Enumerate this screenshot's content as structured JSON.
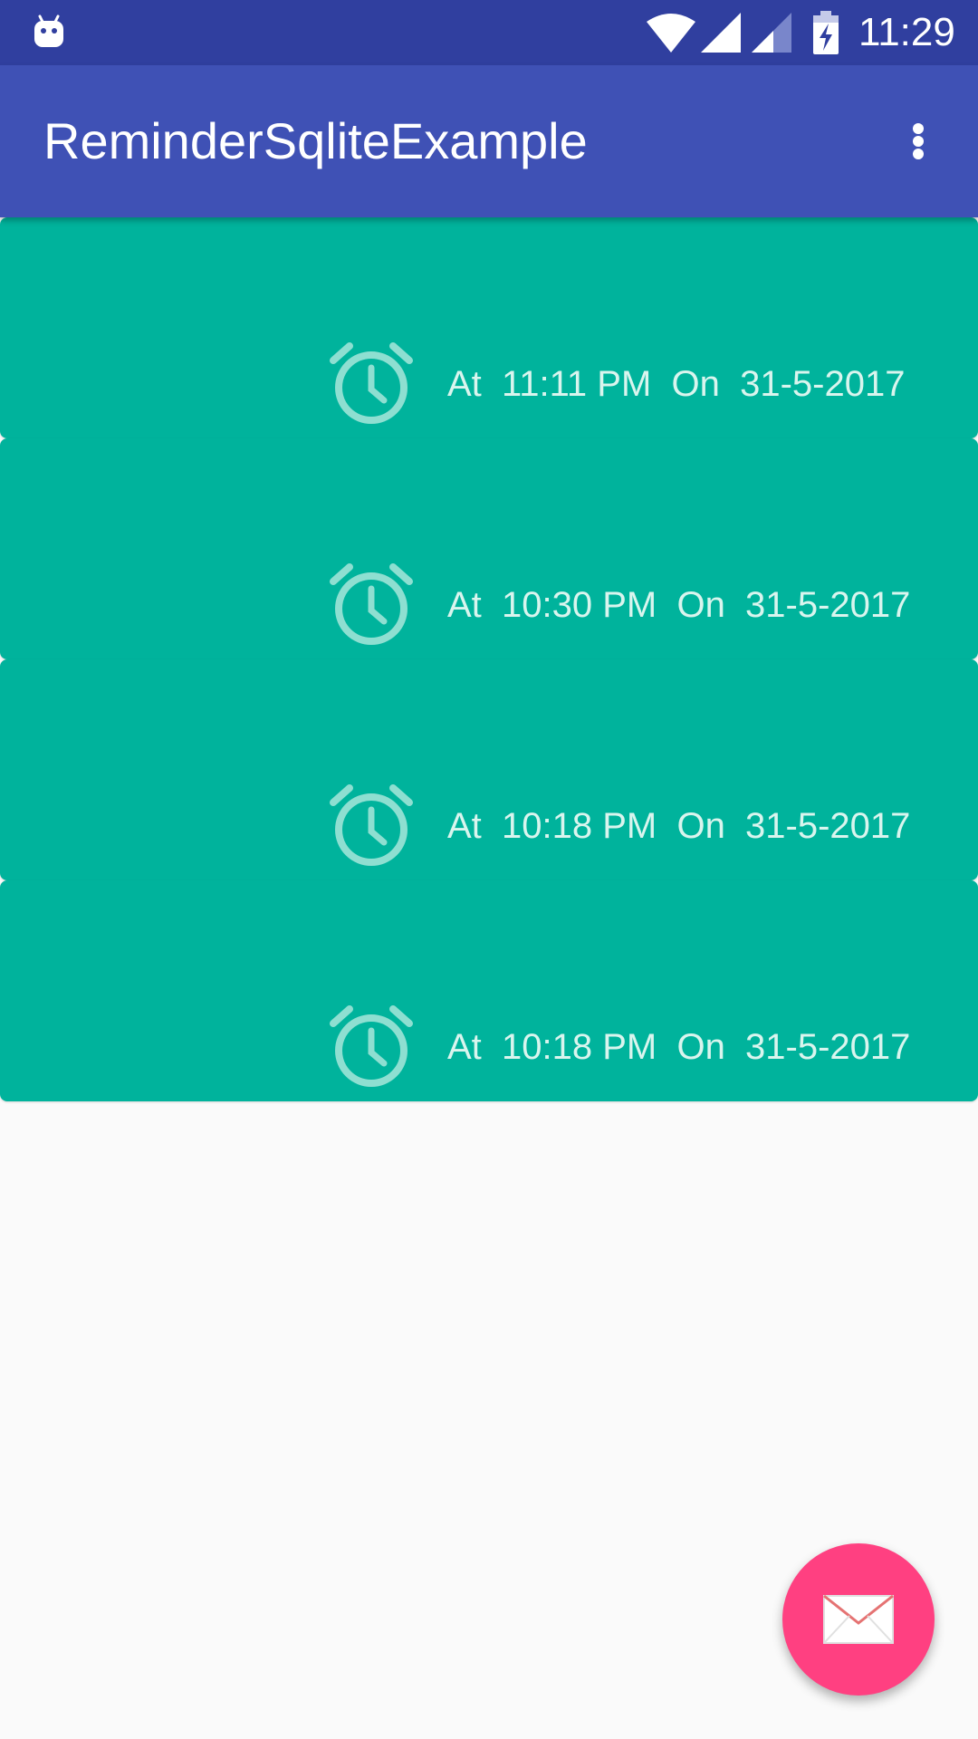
{
  "status_bar": {
    "time": "11:29",
    "icons": [
      "android-notification-icon",
      "wifi-icon",
      "signal-icon",
      "signal-icon",
      "battery-charging-icon"
    ]
  },
  "app_bar": {
    "title": "ReminderSqliteExample",
    "menu_icon": "more-vert-icon"
  },
  "reminders": [
    {
      "text": "At  11:11 PM  On  31-5-2017",
      "icon": "alarm-icon"
    },
    {
      "text": "At  10:30 PM  On  31-5-2017",
      "icon": "alarm-icon"
    },
    {
      "text": "At  10:18 PM  On  31-5-2017",
      "icon": "alarm-icon"
    },
    {
      "text": "At  10:18 PM  On  31-5-2017",
      "icon": "alarm-icon"
    }
  ],
  "fab": {
    "icon": "mail-icon"
  },
  "colors": {
    "status_bar": "#303f9f",
    "app_bar": "#3f51b5",
    "card": "#00b39c",
    "fab": "#ff4081",
    "background": "#fafafa"
  }
}
